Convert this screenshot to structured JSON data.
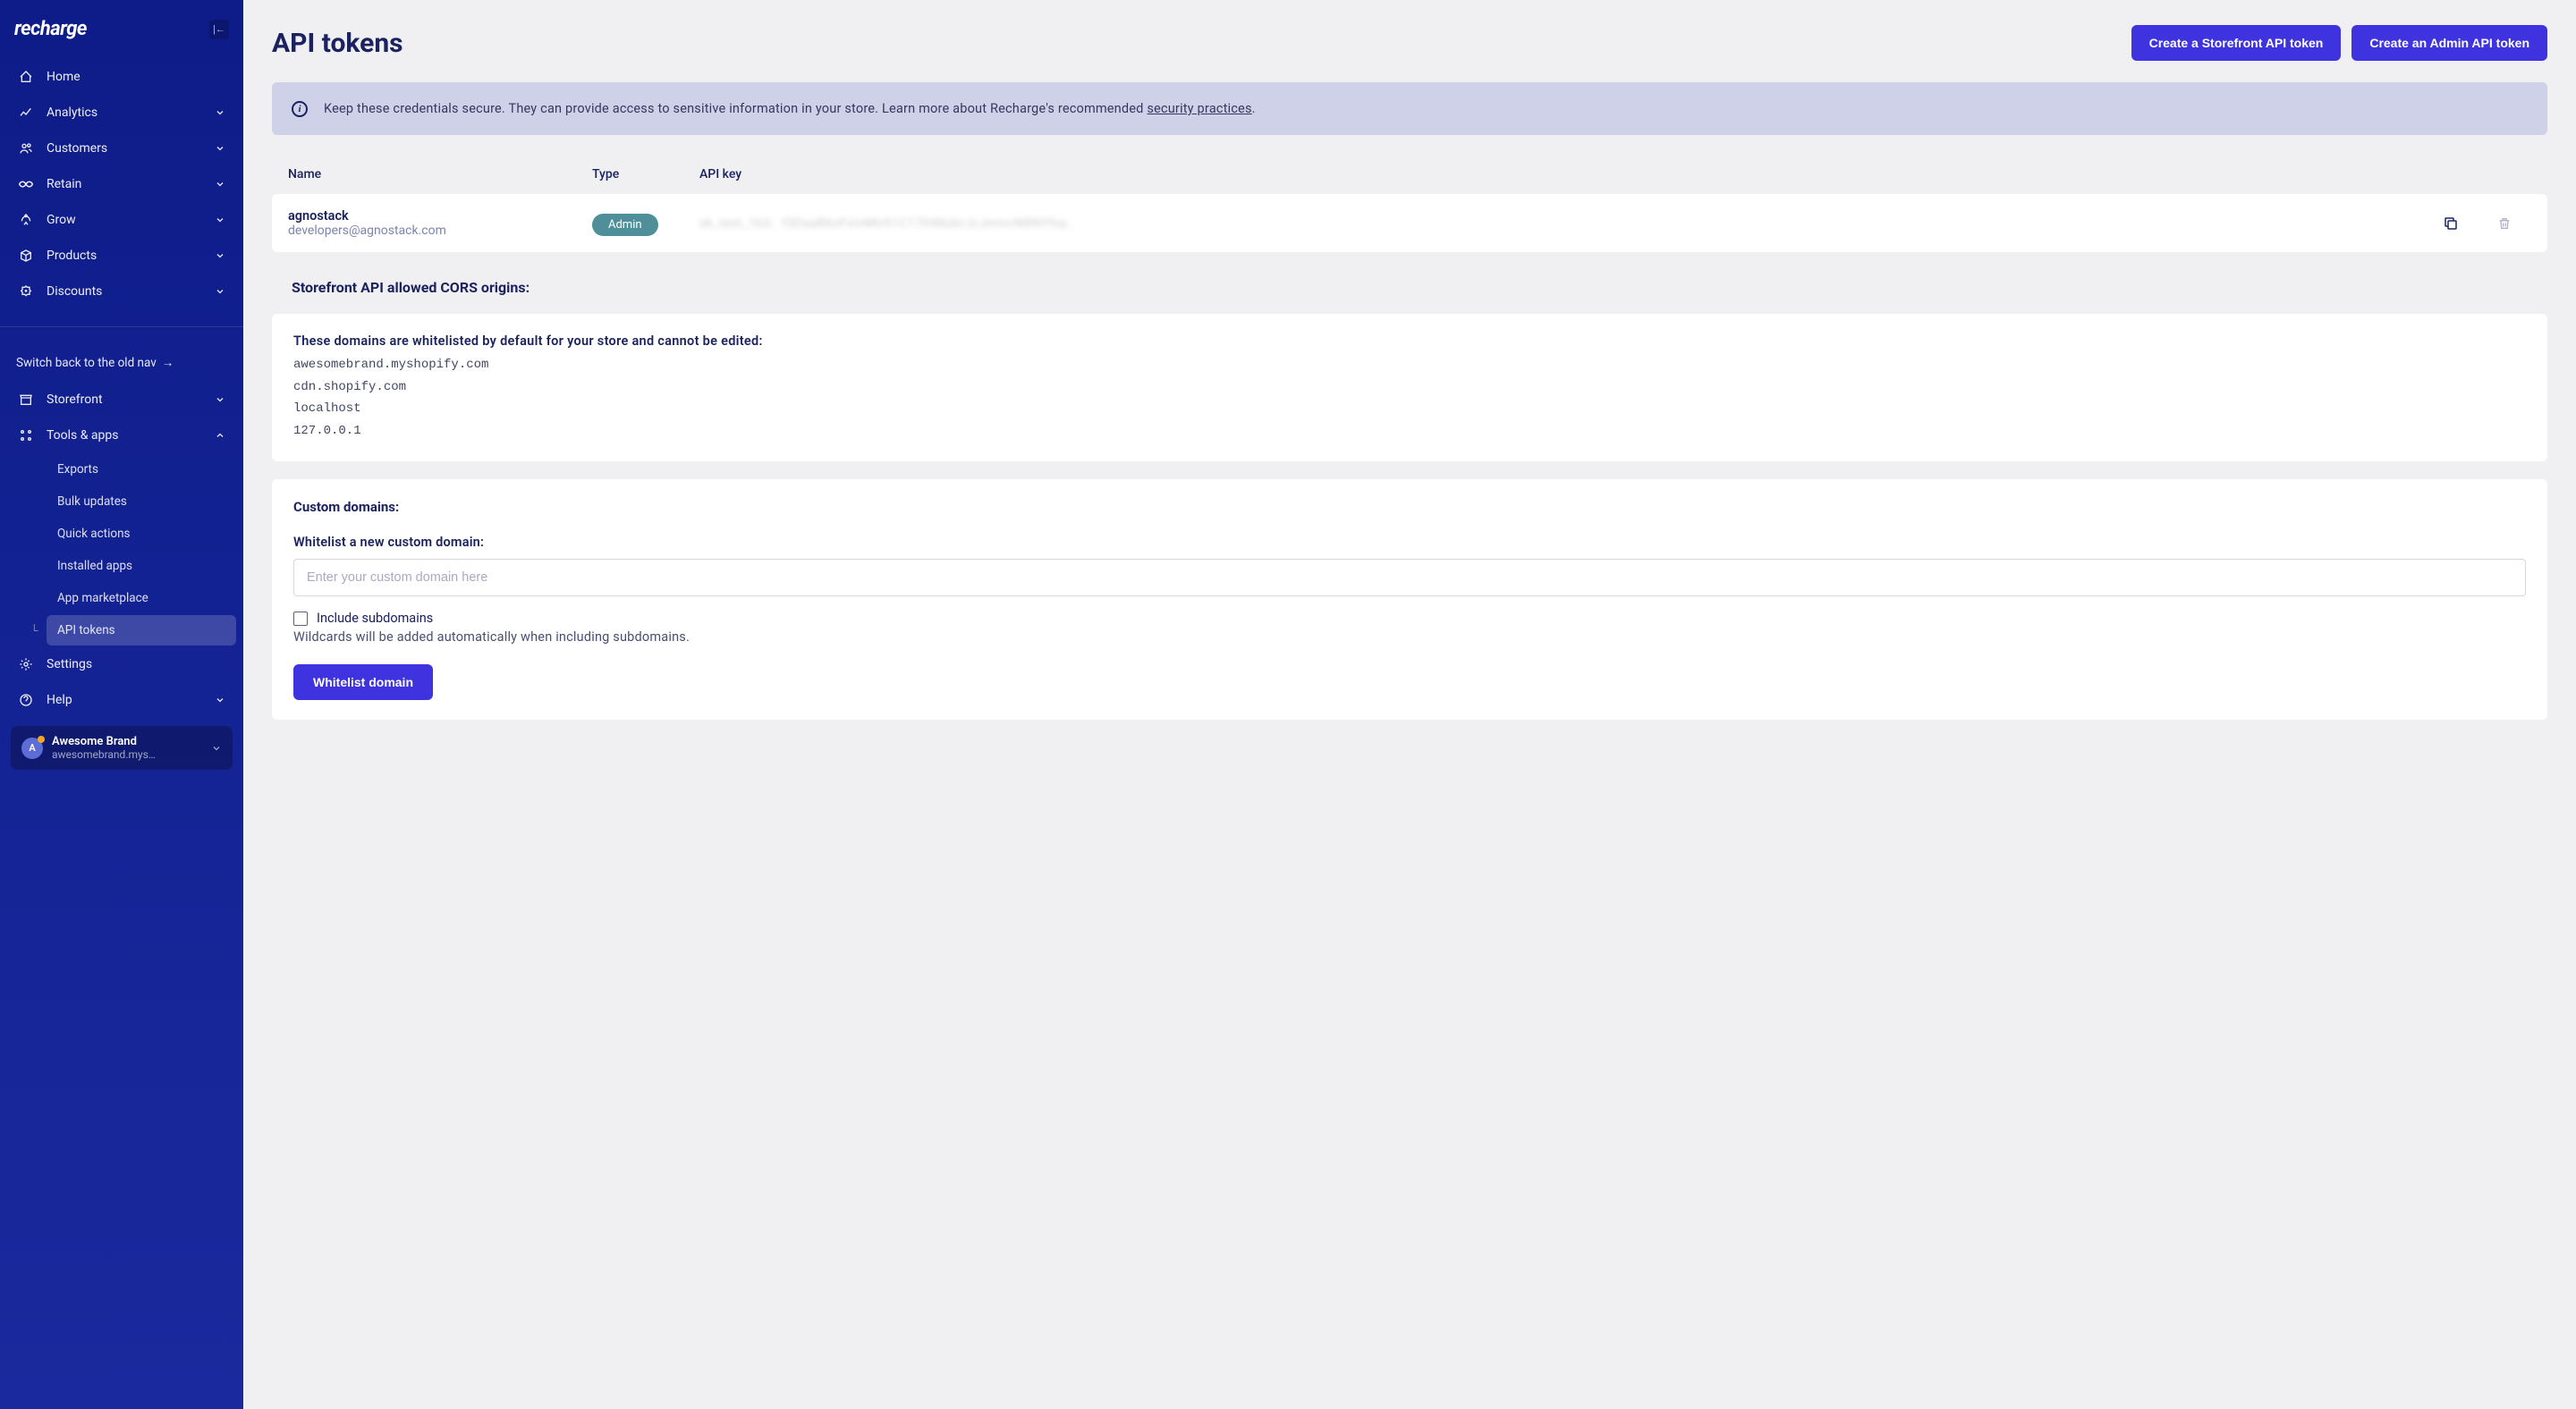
{
  "logo": "recharge",
  "sidebar": {
    "items": [
      {
        "label": "Home",
        "expandable": false
      },
      {
        "label": "Analytics",
        "expandable": true
      },
      {
        "label": "Customers",
        "expandable": true
      },
      {
        "label": "Retain",
        "expandable": true
      },
      {
        "label": "Grow",
        "expandable": true
      },
      {
        "label": "Products",
        "expandable": true
      },
      {
        "label": "Discounts",
        "expandable": true
      }
    ],
    "switch_label": "Switch back to the old nav",
    "storefront": "Storefront",
    "tools": "Tools & apps",
    "tools_children": [
      {
        "label": "Exports"
      },
      {
        "label": "Bulk updates"
      },
      {
        "label": "Quick actions"
      },
      {
        "label": "Installed apps"
      },
      {
        "label": "App marketplace"
      },
      {
        "label": "API tokens",
        "active": true
      }
    ],
    "settings": "Settings",
    "help": "Help",
    "brand": {
      "initial": "A",
      "name": "Awesome Brand",
      "sub": "awesomebrand.mys…"
    }
  },
  "page": {
    "title": "API tokens",
    "btn_storefront": "Create a Storefront API token",
    "btn_admin": "Create an Admin API token"
  },
  "alert": {
    "text_a": "Keep these credentials secure. They can provide access to sensitive information in your store. Learn more about Recharge's recommended ",
    "link": "security practices",
    "text_b": "."
  },
  "table": {
    "col_name": "Name",
    "col_type": "Type",
    "col_key": "API key",
    "row": {
      "name": "agnostack",
      "email": "developers@agnostack.com",
      "type": "Admin",
      "key": "sk_test_1b3.. f3DaaB6zFxIvMlr91C1704NzkrJcJnnvcN8NYfoy.."
    }
  },
  "cors": {
    "title": "Storefront API allowed CORS origins:",
    "intro": "These domains are whitelisted by default for your store and cannot be edited:",
    "domains": [
      "awesomebrand.myshopify.com",
      "cdn.shopify.com",
      "localhost",
      "127.0.0.1"
    ]
  },
  "custom": {
    "title": "Custom domains:",
    "label": "Whitelist a new custom domain:",
    "placeholder": "Enter your custom domain here",
    "checkbox": "Include subdomains",
    "help": "Wildcards will be added automatically when including subdomains.",
    "submit": "Whitelist domain"
  }
}
